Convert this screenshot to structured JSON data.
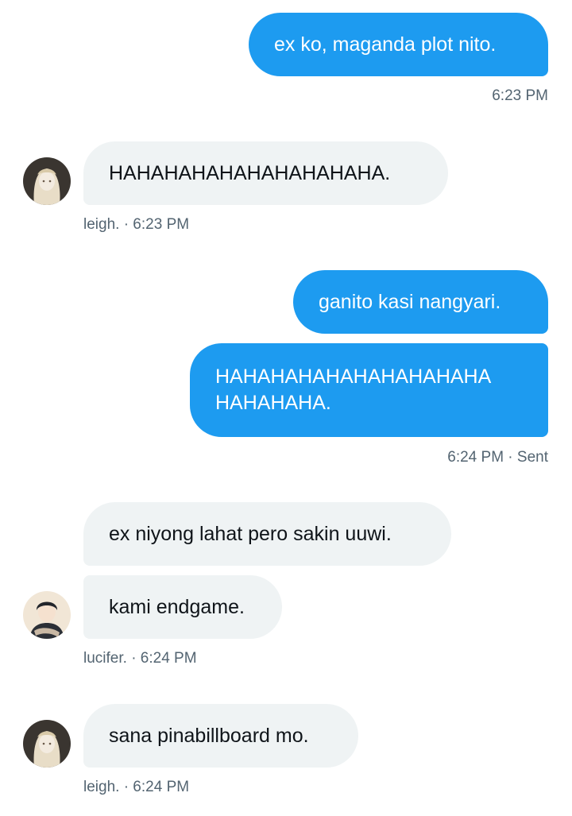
{
  "messages": [
    {
      "text": "ex ko, maganda plot nito.",
      "meta": "6:23 PM"
    },
    {
      "text": "HAHAHAHAHAHAHAHAHAHA.",
      "meta": "leigh. · 6:23 PM",
      "avatar": "long-hair-user-avatar"
    },
    {
      "text": "ganito kasi nangyari."
    },
    {
      "text": "HAHAHAHAHAHAHAHAHAHA\nHAHAHAHA.",
      "meta": "6:24 PM · Sent"
    },
    {
      "text": "ex niyong lahat pero sakin uuwi."
    },
    {
      "text": "kami endgame.",
      "meta": "lucifer. · 6:24 PM",
      "avatar": "dark-hair-user-avatar"
    },
    {
      "text": "sana pinabillboard mo.",
      "meta": "leigh. · 6:24 PM",
      "avatar": "long-hair-user-avatar"
    }
  ],
  "colors": {
    "sent_bubble": "#1d9bf0",
    "received_bubble": "#eff3f4",
    "meta_text": "#536471"
  }
}
